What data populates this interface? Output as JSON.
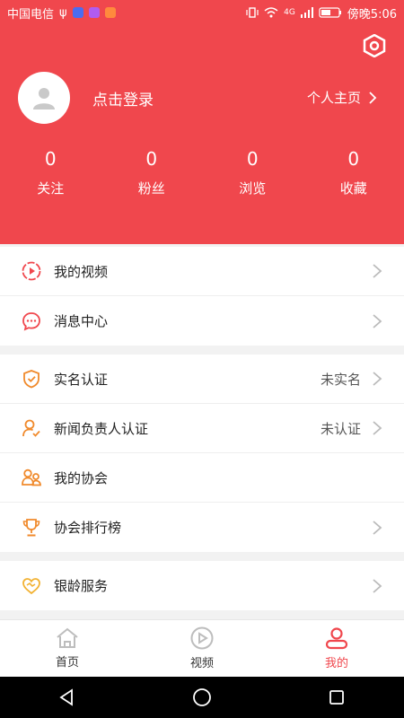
{
  "status_bar": {
    "carrier": "中国电信",
    "usb": "ψ",
    "network": "4G",
    "time": "傍晚5:06"
  },
  "header": {
    "login_text": "点击登录",
    "profile_link": "个人主页",
    "stats": [
      {
        "value": "0",
        "label": "关注"
      },
      {
        "value": "0",
        "label": "粉丝"
      },
      {
        "value": "0",
        "label": "浏览"
      },
      {
        "value": "0",
        "label": "收藏"
      }
    ]
  },
  "sections": {
    "s1": [
      {
        "label": "我的视频"
      },
      {
        "label": "消息中心"
      }
    ],
    "s2": [
      {
        "label": "实名认证",
        "value": "未实名"
      },
      {
        "label": "新闻负责人认证",
        "value": "未认证"
      },
      {
        "label": "我的协会"
      },
      {
        "label": "协会排行榜"
      }
    ],
    "s3": [
      {
        "label": "银龄服务"
      }
    ]
  },
  "tabbar": {
    "tabs": [
      {
        "label": "首页"
      },
      {
        "label": "视频"
      },
      {
        "label": "我的"
      }
    ]
  },
  "colors": {
    "brand": "#f0474d",
    "icon_orange": "#f08a2c"
  }
}
